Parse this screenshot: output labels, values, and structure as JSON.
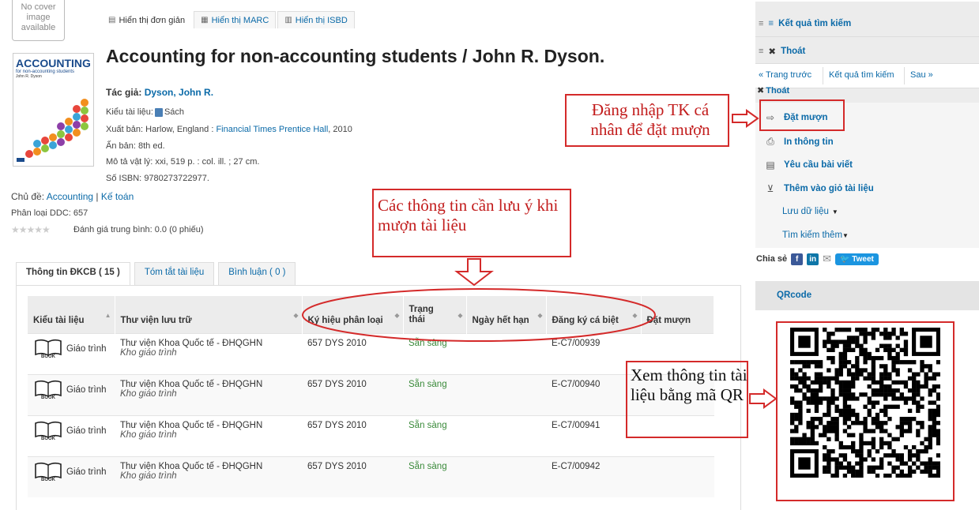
{
  "no_cover": "No cover image available",
  "view_tabs": [
    {
      "label": "Hiển thị đơn giản",
      "icon": "page-icon",
      "active": true
    },
    {
      "label": "Hiển thị MARC",
      "icon": "grid-icon",
      "active": false
    },
    {
      "label": "Hiển thị ISBD",
      "icon": "list-icon",
      "active": false
    }
  ],
  "cover": {
    "title": "ACCOUNTING",
    "subtitle": "for non-accounting students",
    "author": "John R. Dyson"
  },
  "record": {
    "title": "Accounting for non-accounting students / John R. Dyson.",
    "author_label": "Tác giả:",
    "author": "Dyson, John R.",
    "type_label": "Kiểu tài liệu:",
    "type": "Sách",
    "publisher_label": "Xuất bản:",
    "publisher_place": "Harlow, England :",
    "publisher": "Financial Times Prentice Hall",
    "publisher_year": ", 2010",
    "edition_label": "Ấn bản:",
    "edition": "8th ed.",
    "physical_label": "Mô tả vật lý:",
    "physical": "xxi, 519 p. : col. ill. ; 27 cm.",
    "isbn_label": "Số ISBN:",
    "isbn": "9780273722977.",
    "subject_label": "Chủ đề:",
    "subject1": "Accounting",
    "subject_sep": " | ",
    "subject2": "Kế toán",
    "ddc_label": "Phân loại DDC:",
    "ddc": "657",
    "rating_label": "Đánh giá trung bình: 0.0 (0 phiếu)",
    "rating_value": 0
  },
  "holding_tabs": [
    "Thông tin ĐKCB ( 15 )",
    "Tóm tắt tài liệu",
    "Bình luận ( 0 )"
  ],
  "table": {
    "headers": [
      "Kiểu tài liệu",
      "Thư viện lưu trữ",
      "Ký hiệu phân loại",
      "Trạng thái",
      "Ngày hết hạn",
      "Đăng ký cá biệt",
      "Đặt mượn"
    ],
    "book_label": "BOOK",
    "rows": [
      {
        "type": "Giáo trình",
        "library": "Thư viện Khoa Quốc tế - ĐHQGHN",
        "collection": "Kho giáo trình",
        "callno": "657 DYS 2010",
        "status": "Sẵn sàng",
        "due": "",
        "barcode": "E-C7/00939"
      },
      {
        "type": "Giáo trình",
        "library": "Thư viện Khoa Quốc tế - ĐHQGHN",
        "collection": "Kho giáo trình",
        "callno": "657 DYS 2010",
        "status": "Sẵn sàng",
        "due": "",
        "barcode": "E-C7/00940"
      },
      {
        "type": "Giáo trình",
        "library": "Thư viện Khoa Quốc tế - ĐHQGHN",
        "collection": "Kho giáo trình",
        "callno": "657 DYS 2010",
        "status": "Sẵn sàng",
        "due": "",
        "barcode": "E-C7/00941"
      },
      {
        "type": "Giáo trình",
        "library": "Thư viện Khoa Quốc tế - ĐHQGHN",
        "collection": "Kho giáo trình",
        "callno": "657 DYS 2010",
        "status": "Sẵn sàng",
        "due": "",
        "barcode": "E-C7/00942"
      }
    ]
  },
  "sidebar": {
    "results": "Kết quả tìm kiếm",
    "exit": "Thoát",
    "prev": "« Trang trước",
    "results_link": "Kết quả tìm kiếm",
    "next": "Sau »",
    "exit2": "Thoát",
    "actions": [
      {
        "label": "Đặt mượn",
        "icon": "reserve-icon"
      },
      {
        "label": "In thông tin",
        "icon": "print-icon"
      },
      {
        "label": "Yêu cầu bài viết",
        "icon": "request-icon"
      },
      {
        "label": "Thêm vào giỏ tài liệu",
        "icon": "cart-icon"
      },
      {
        "label": "Lưu dữ liệu",
        "icon": ""
      },
      {
        "label": "Tìm kiếm thêm",
        "icon": ""
      }
    ],
    "share": "Chia sẻ",
    "tweet": "Tweet",
    "qr_title": "QRcode"
  },
  "annotations": {
    "login": "Đăng nhập TK cá nhân để đặt mượn",
    "info": "Các thông tin cần lưu ý khi mượn tài liệu",
    "qr": "Xem thông tin tài liệu bằng mã QR"
  },
  "colors": {
    "link": "#0b6aa8",
    "annotation": "#d42a2a",
    "available": "#3a8a3a"
  }
}
